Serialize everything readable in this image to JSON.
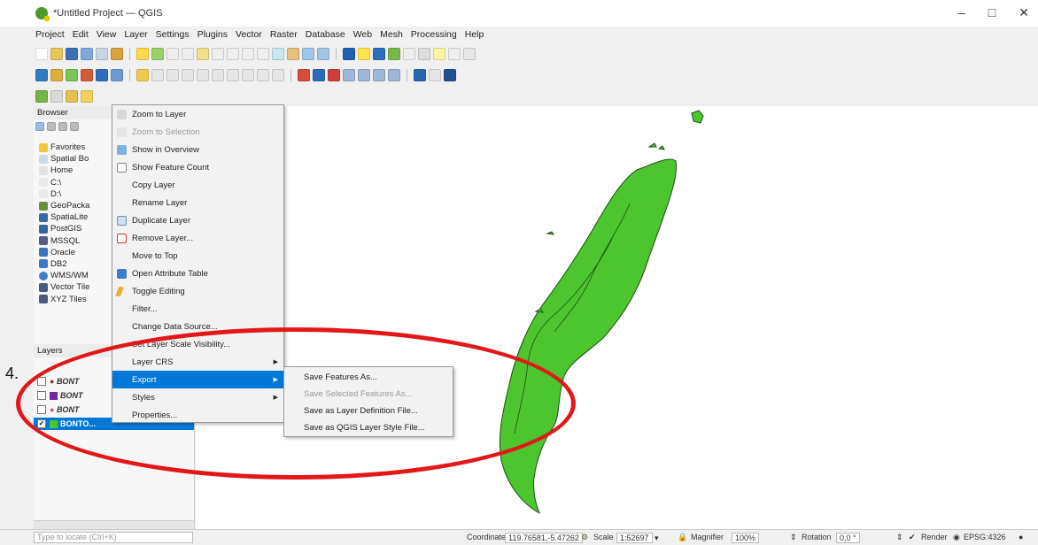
{
  "window": {
    "title": "*Untitled Project — QGIS",
    "controls": [
      "–",
      "□",
      "✕"
    ]
  },
  "menubar": [
    "Project",
    "Edit",
    "View",
    "Layer",
    "Settings",
    "Plugins",
    "Vector",
    "Raster",
    "Database",
    "Web",
    "Mesh",
    "Processing",
    "Help"
  ],
  "browser": {
    "title": "Browser",
    "items": [
      "Favorites",
      "Spatial Bo",
      "Home",
      "C:\\",
      "D:\\",
      "GeoPacka",
      "SpatiaLite",
      "PostGIS",
      "MSSQL",
      "Oracle",
      "DB2",
      "WMS/WM",
      "Vector Tile",
      "XYZ Tiles"
    ]
  },
  "layers": {
    "title": "Layers",
    "rows": [
      "BONT",
      "BONT",
      "BONT",
      "BONTO..."
    ]
  },
  "context_menu": {
    "items": [
      {
        "label": "Zoom to Layer",
        "icon": "zoom-layer-icon",
        "disabled": false
      },
      {
        "label": "Zoom to Selection",
        "icon": "zoom-selection-icon",
        "disabled": true
      },
      {
        "label": "Show in Overview",
        "icon": "overview-icon",
        "disabled": false
      },
      {
        "label": "Show Feature Count",
        "icon": "checkbox-icon",
        "disabled": false
      },
      {
        "label": "Copy Layer",
        "icon": "",
        "disabled": false
      },
      {
        "label": "Rename Layer",
        "icon": "",
        "disabled": false
      },
      {
        "label": "Duplicate Layer",
        "icon": "duplicate-icon",
        "disabled": false
      },
      {
        "label": "Remove Layer...",
        "icon": "remove-icon",
        "disabled": false
      },
      {
        "label": "Move to Top",
        "icon": "",
        "disabled": false
      },
      {
        "label": "Open Attribute Table",
        "icon": "table-icon",
        "disabled": false
      },
      {
        "label": "Toggle Editing",
        "icon": "pencil-icon",
        "disabled": false
      },
      {
        "label": "Filter...",
        "icon": "",
        "disabled": false
      },
      {
        "label": "Change Data Source...",
        "icon": "",
        "disabled": false
      },
      {
        "label": "Set Layer Scale Visibility...",
        "icon": "",
        "disabled": false
      },
      {
        "label": "Layer CRS",
        "icon": "",
        "disabled": false,
        "submenu": true
      },
      {
        "label": "Export",
        "icon": "",
        "disabled": false,
        "submenu": true,
        "highlighted": true
      },
      {
        "label": "Styles",
        "icon": "",
        "disabled": false,
        "submenu": true
      },
      {
        "label": "Properties...",
        "icon": "",
        "disabled": false
      }
    ]
  },
  "export_submenu": [
    {
      "label": "Save Features As...",
      "disabled": false
    },
    {
      "label": "Save Selected Features As...",
      "disabled": true
    },
    {
      "label": "Save as Layer Definition File...",
      "disabled": false
    },
    {
      "label": "Save as QGIS Layer Style File...",
      "disabled": false
    }
  ],
  "annotation": {
    "step": "4."
  },
  "statusbar": {
    "locate_placeholder": "Type to locate (Ctrl+K)",
    "coordinate_label": "Coordinate",
    "coordinate": "119.76581,-5.47262",
    "scale_label": "Scale",
    "scale": "1:52697",
    "magnifier_label": "Magnifier",
    "magnifier": "100%",
    "rotation_label": "Rotation",
    "rotation": "0,0 °",
    "render_label": "Render",
    "crs": "EPSG:4326"
  },
  "colors": {
    "highlight": "#0078d7",
    "map_fill": "#4cc52e",
    "ellipse": "#e21818"
  }
}
